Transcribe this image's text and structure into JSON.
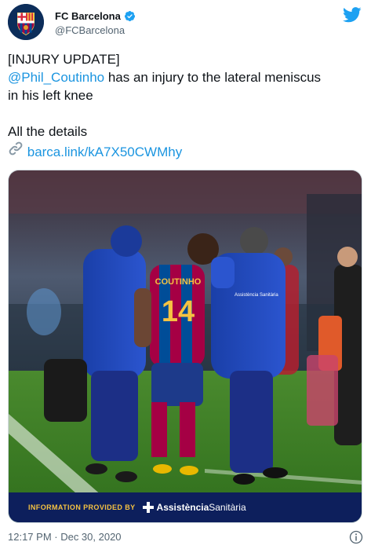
{
  "account": {
    "name": "FC Barcelona",
    "handle": "@FCBarcelona"
  },
  "tweet": {
    "line1": "[INJURY UPDATE]",
    "mention": "@Phil_Coutinho",
    "line2_rest": " has an injury to the lateral meniscus",
    "line3": "in his left knee",
    "line4": "All the details",
    "link": "barca.link/kA7X50CWMhy"
  },
  "media": {
    "jersey_name": "COUTINHO",
    "jersey_number": "14",
    "sponsor_label": "INFORMATION PROVIDED BY",
    "sponsor_bold": "Assistència",
    "sponsor_normal": "Sanitària",
    "staff_badge_1": "Assistència Sanitària"
  },
  "footer": {
    "timestamp": "12:17 PM · Dec 30, 2020"
  },
  "colors": {
    "link": "#1b95e0",
    "twitter_blue": "#1da1f2",
    "secondary_text": "#536471",
    "sponsor_bg": "#0d1f5c",
    "sponsor_text": "#f5c242"
  },
  "icons": {
    "twitter": "twitter-bird-icon",
    "verified": "verified-badge-icon",
    "link": "link-icon",
    "info": "info-icon"
  }
}
